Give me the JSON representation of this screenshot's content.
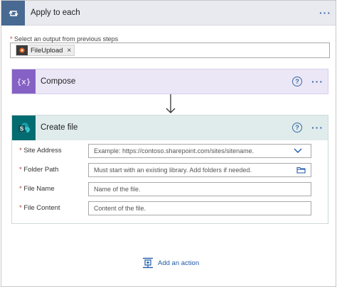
{
  "apply_to_each": {
    "title": "Apply to each",
    "select_label_required": "*",
    "select_label": " Select an output from previous steps",
    "token": {
      "label": "FileUpload",
      "remove": "×"
    }
  },
  "compose": {
    "title": "Compose",
    "icon_text": "{x}"
  },
  "create_file": {
    "title": "Create file",
    "fields": [
      {
        "required": "*",
        "label": " Site Address",
        "placeholder": "Example: https://contoso.sharepoint.com/sites/sitename."
      },
      {
        "required": "*",
        "label": " Folder Path",
        "placeholder": "Must start with an existing library. Add folders if needed."
      },
      {
        "required": "*",
        "label": " File Name",
        "placeholder": "Name of the file."
      },
      {
        "required": "*",
        "label": " File Content",
        "placeholder": "Content of the file."
      }
    ]
  },
  "menu_dots": "···",
  "help_glyph": "?",
  "add_action": {
    "label": "Add an action"
  },
  "colors": {
    "apply_to_each_icon_bg": "#486991",
    "compose_icon_bg": "#8661c5",
    "sharepoint_bg": "#036c70",
    "link_blue": "#1e5aa8"
  },
  "icons": [
    "loop-icon",
    "fileupload-app-icon",
    "compose-variable-icon",
    "sharepoint-icon",
    "help-icon",
    "more-options-icon",
    "chevron-down-icon",
    "folder-icon",
    "add-action-icon",
    "down-arrow-icon"
  ]
}
